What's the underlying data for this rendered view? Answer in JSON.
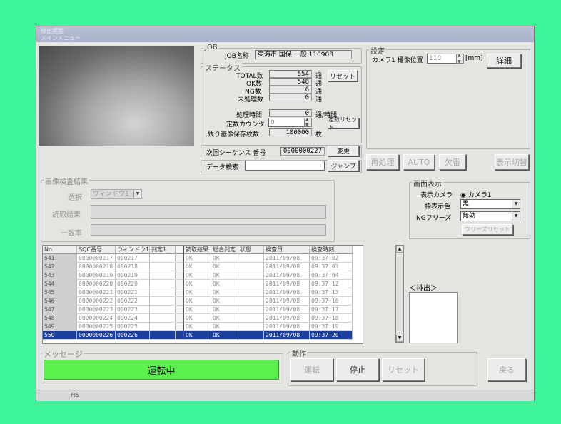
{
  "window": {
    "title_line1": "検出画面",
    "title_line2": "メインメニュー"
  },
  "job": {
    "group_label": "JOB",
    "name_label": "JOB名称",
    "name_value": "東海市 国保 一般 110908"
  },
  "status": {
    "group_label": "ステータス",
    "total_label": "TOTAL数",
    "total_value": "554",
    "total_unit": "通",
    "ok_label": "OK数",
    "ok_value": "548",
    "ok_unit": "通",
    "ng_label": "NG数",
    "ng_value": "6",
    "ng_unit": "通",
    "unproc_label": "未処理数",
    "unproc_value": "0",
    "unproc_unit": "通",
    "reset_button": "リセット",
    "rate_label": "処理時間",
    "rate_value": "0",
    "rate_unit": "通/時間",
    "counter_label": "定数カウンタ",
    "counter_value": "0",
    "counter_reset_button": "定数リセット",
    "remain_label": "残り画像保存枚数",
    "remain_value": "100000",
    "remain_unit": "枚"
  },
  "sequence": {
    "label": "次回シーケンス 番号",
    "value": "0000000227",
    "change_button": "変更"
  },
  "data_search": {
    "label": "データ検索",
    "value": "",
    "jump_button": "ジャンプ"
  },
  "settings": {
    "group_label": "設定",
    "camera_pos_label": "カメラ1 撮像位置",
    "camera_pos_value": "110",
    "camera_pos_unit": "[mm]",
    "detail_button": "詳細"
  },
  "mid_buttons": {
    "reprocess": "再処理",
    "auto": "AUTO",
    "missing": "欠番",
    "display_switch": "表示切替"
  },
  "inspection": {
    "group_label": "画像検査結果",
    "select_label": "選択",
    "select_value": "ウィンドウ1",
    "read_label": "読取結果",
    "read_value": "",
    "match_label": "一致率",
    "match_value": ""
  },
  "display": {
    "group_label": "画面表示",
    "camera_label": "表示カメラ",
    "camera_value": "カメラ1",
    "frame_color_label": "枠表示色",
    "frame_color_value": "黒",
    "ng_freeze_label": "NGフリーズ",
    "ng_freeze_value": "無効",
    "freeze_reset_button": "フリーズリセット"
  },
  "eject": {
    "label": "＜排出＞"
  },
  "table": {
    "headers": [
      "No",
      "SQC番号",
      "ウィンドウ1",
      "判定1",
      "",
      "読取結果",
      "総合判定",
      "状態",
      "検査日",
      "検査時刻"
    ],
    "rows": [
      [
        "541",
        "0000000217",
        "000217",
        "",
        "",
        "OK",
        "OK",
        "",
        "2011/09/08",
        "09:37:02"
      ],
      [
        "542",
        "0000000218",
        "000218",
        "",
        "",
        "OK",
        "OK",
        "",
        "2011/09/08",
        "09:37:03"
      ],
      [
        "543",
        "0000000219",
        "000219",
        "",
        "",
        "OK",
        "OK",
        "",
        "2011/09/08",
        "09:37:04"
      ],
      [
        "544",
        "0000000220",
        "000220",
        "",
        "",
        "OK",
        "OK",
        "",
        "2011/09/08",
        "09:37:12"
      ],
      [
        "545",
        "0000000221",
        "000221",
        "",
        "",
        "OK",
        "OK",
        "",
        "2011/09/08",
        "09:37:13"
      ],
      [
        "546",
        "0000000222",
        "000222",
        "",
        "",
        "OK",
        "OK",
        "",
        "2011/09/08",
        "09:37:16"
      ],
      [
        "547",
        "0000000223",
        "000223",
        "",
        "",
        "OK",
        "OK",
        "",
        "2011/09/08",
        "09:37:17"
      ],
      [
        "548",
        "0000000224",
        "000224",
        "",
        "",
        "OK",
        "OK",
        "",
        "2011/09/08",
        "09:37:18"
      ],
      [
        "549",
        "0000000225",
        "000225",
        "",
        "",
        "OK",
        "OK",
        "",
        "2011/09/08",
        "09:37:19"
      ],
      [
        "550",
        "0000000226",
        "000226",
        "",
        "",
        "OK",
        "OK",
        "",
        "2011/09/08",
        "09:37:20"
      ]
    ],
    "selected_row": "550"
  },
  "message": {
    "group_label": "メッセージ",
    "text": "運転中",
    "color": "#5cf04e"
  },
  "operation": {
    "group_label": "動作",
    "run_button": "運転",
    "stop_button": "停止",
    "reset_button": "リセット"
  },
  "back_button": "戻る",
  "taskbar": {
    "item": "FIS"
  }
}
